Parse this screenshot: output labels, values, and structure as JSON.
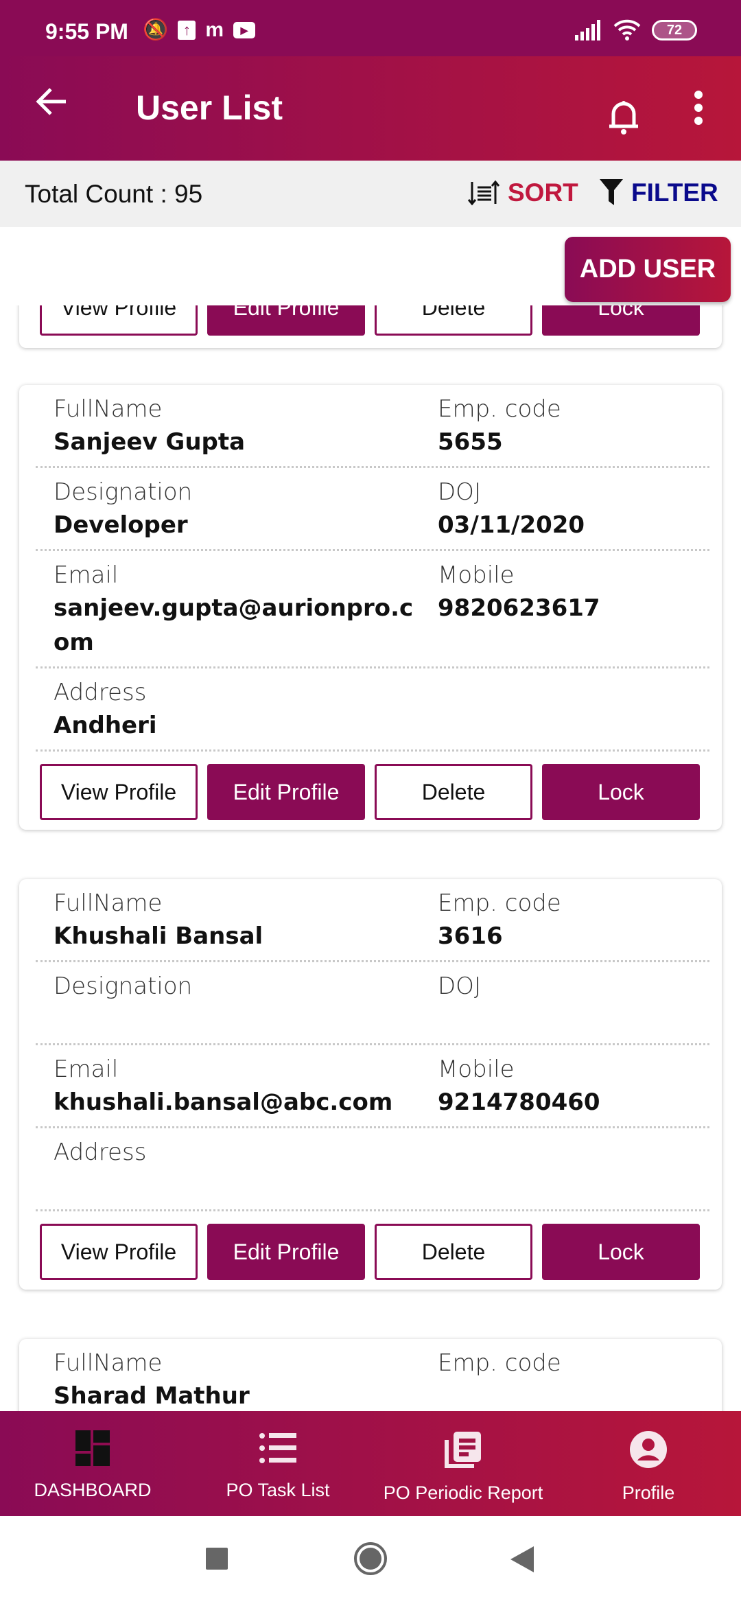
{
  "status_bar": {
    "time": "9:55 PM",
    "battery": "72",
    "icons": [
      "mute-icon",
      "upload-icon",
      "m-app-icon",
      "youtube-icon",
      "signal-icon",
      "wifi-icon",
      "battery-icon"
    ]
  },
  "header": {
    "title": "User List",
    "icons": [
      "back-arrow-icon",
      "bell-icon",
      "more-vert-icon"
    ]
  },
  "toolbar": {
    "total_count": "Total Count : 95",
    "sort_label": "SORT",
    "filter_label": "FILTER"
  },
  "add_user_label": "ADD USER",
  "labels": {
    "fullname": "FullName",
    "emp_code": "Emp. code",
    "designation": "Designation",
    "doj": "DOJ",
    "email": "Email",
    "mobile": "Mobile",
    "address": "Address"
  },
  "buttons": {
    "view": "View Profile",
    "edit": "Edit Profile",
    "delete": "Delete",
    "lock": "Lock"
  },
  "users": [
    {
      "fullname": "Sanjeev Gupta",
      "emp_code": "5655",
      "designation": "Developer",
      "doj": "03/11/2020",
      "email": "sanjeev.gupta@aurionpro.com",
      "mobile": "9820623617",
      "address": "Andheri"
    },
    {
      "fullname": "Khushali Bansal",
      "emp_code": "3616",
      "designation": "",
      "doj": "",
      "email": "khushali.bansal@abc.com",
      "mobile": "9214780460",
      "address": ""
    },
    {
      "fullname": "Sharad Mathur",
      "emp_code": ""
    }
  ],
  "bottom_nav": [
    {
      "label": "DASHBOARD",
      "icon": "dashboard-icon"
    },
    {
      "label": "PO Task List",
      "icon": "list-icon"
    },
    {
      "label": "PO Periodic Report",
      "icon": "report-icon"
    },
    {
      "label": "Profile",
      "icon": "account-circle-icon"
    }
  ],
  "colors": {
    "primary": "#8a0b55",
    "gradient_end": "#b7163a",
    "sort": "#c0183e",
    "filter": "#0a0a8c"
  }
}
